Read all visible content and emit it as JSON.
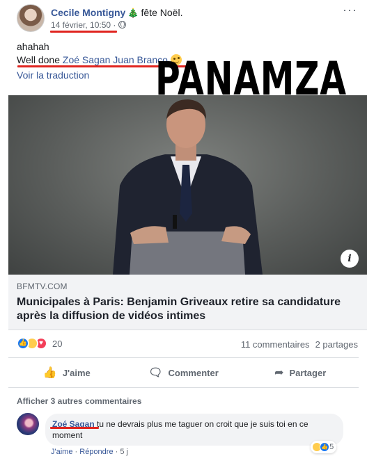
{
  "post": {
    "author": "Cecile Montigny",
    "feeling": "fête Noël.",
    "timestamp": "14 février, 10:50",
    "timestamp_sep": "·",
    "text_line1": "ahahah",
    "text_prefix": "Well done",
    "mention": "Zoé Sagan Juan Branco",
    "translate": "Voir la traduction",
    "watermark": "PANAMZA"
  },
  "link": {
    "source": "BFMTV.COM",
    "title": "Municipales à Paris: Benjamin Griveaux retire sa candidature après la diffusion de vidéos intimes",
    "info_label": "i"
  },
  "stats": {
    "reaction_count": "20",
    "comments": "11 commentaires",
    "shares": "2 partages"
  },
  "actions": {
    "like": "J'aime",
    "comment": "Commenter",
    "share": "Partager"
  },
  "comments": {
    "more": "Afficher 3 autres commentaires",
    "author": "Zoé Sagan",
    "text": "tu ne devrais plus me taguer on croit que je suis toi en ce moment",
    "reaction_count": "5",
    "like": "J'aime",
    "dot": "·",
    "reply": "Répondre",
    "age": "5 j"
  },
  "colors": {
    "link_blue": "#385898",
    "underline_red": "#e0241f",
    "like_blue": "#1877f2"
  }
}
